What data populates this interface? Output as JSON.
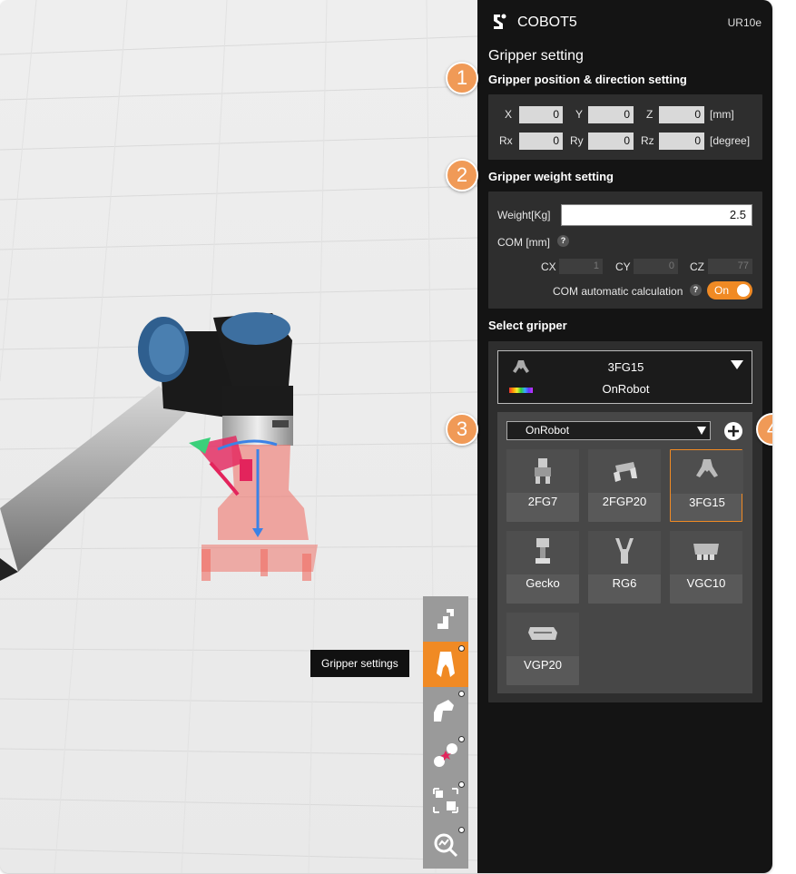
{
  "app": {
    "title": "COBOT5",
    "model": "UR10e"
  },
  "gripper": {
    "section_title": "Gripper setting",
    "position": {
      "title": "Gripper position & direction setting",
      "fields": [
        {
          "label": "X",
          "value": "0"
        },
        {
          "label": "Y",
          "value": "0"
        },
        {
          "label": "Z",
          "value": "0"
        },
        {
          "label": "Rx",
          "value": "0"
        },
        {
          "label": "Ry",
          "value": "0"
        },
        {
          "label": "Rz",
          "value": "0"
        }
      ],
      "unit_mm": "[mm]",
      "unit_deg": "[degree]"
    },
    "weight": {
      "title": "Gripper weight setting",
      "weight_label": "Weight[Kg]",
      "weight_value": "2.5",
      "com_label": "COM [mm]",
      "help": "?",
      "com_fields": [
        {
          "label": "CX",
          "value": "1"
        },
        {
          "label": "CY",
          "value": "0"
        },
        {
          "label": "CZ",
          "value": "77"
        }
      ],
      "auto_label": "COM automatic calculation",
      "auto_value": "On"
    },
    "select": {
      "title": "Select gripper",
      "selected_name": "3FG15",
      "selected_brand": "OnRobot",
      "brand_dropdown": "OnRobot",
      "items": [
        "2FG7",
        "2FGP20",
        "3FG15",
        "Gecko",
        "RG6",
        "VGC10",
        "VGP20"
      ]
    }
  },
  "badges": [
    "1",
    "2",
    "3",
    "4"
  ],
  "toolbar": {
    "tooltip": "Gripper settings",
    "tools": [
      "robot-arm-icon",
      "gripper-icon",
      "arm-joint-icon",
      "collision-icon",
      "workspace-icon",
      "analysis-icon"
    ]
  },
  "colors": {
    "accent": "#f08a24",
    "panel": "#141414",
    "badge": "#f09a57"
  }
}
